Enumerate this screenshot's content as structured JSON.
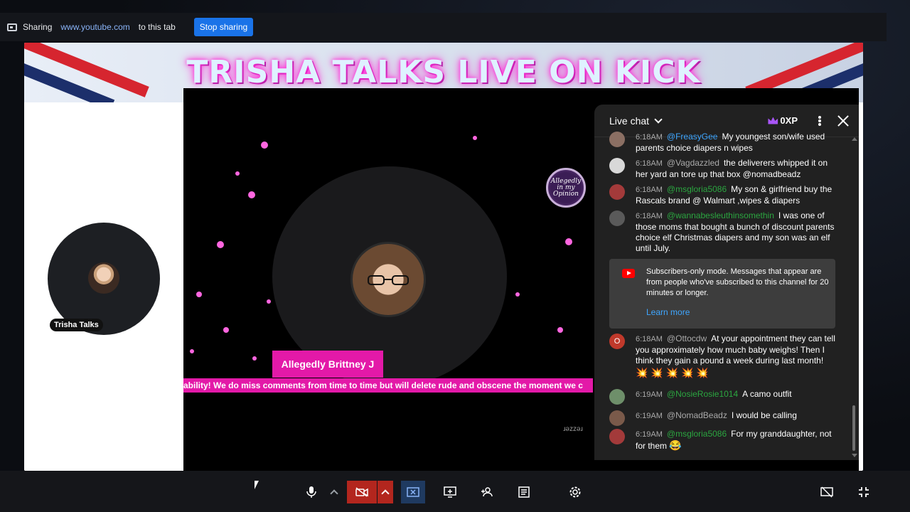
{
  "share_bar": {
    "label": "Sharing",
    "site": "www.youtube.com",
    "suffix": "to this tab",
    "stop_button": "Stop sharing"
  },
  "banner": {
    "title": "TRISHA TALKS LIVE ON KICK"
  },
  "participant": {
    "name": "Trisha Talks"
  },
  "video": {
    "name_tag": "Allegedly Brittney J",
    "ticker": "ability! We do miss comments from time to time but will delete rude and obscene the moment we c",
    "logo_text": "Allegedly in my Opinion",
    "eyes_mark": "ɹǝzzǝɹ"
  },
  "chat": {
    "title": "Live chat",
    "xp": "0XP",
    "messages": [
      {
        "time": "6:18AM",
        "user": "@FreasyGee",
        "text": "My youngest son/wife used parents choice diapers n wipes",
        "member": false
      },
      {
        "time": "6:18AM",
        "user": "@Vagdazzled",
        "text": "the deliverers whipped it on her yard an tore up that box @nomadbeadz",
        "member": false
      },
      {
        "time": "6:18AM",
        "user": "@msgloria5086",
        "text": "My son & girlfriend buy the Rascals brand @ Walmart ,wipes & diapers",
        "member": true
      },
      {
        "time": "6:18AM",
        "user": "@wannabesleuthinsomethin",
        "text": "I was one of those moms that bought a bunch of discount parents choice elf Christmas diapers and my son was an elf until July.",
        "member": true
      },
      {
        "time": "6:18AM",
        "user": "@Ottocdw",
        "text": "At your appointment they can tell you approximately how much baby weighs! Then I think they gain a pound a week during last month!",
        "member": false,
        "avatar_letter": "O",
        "emoji": "💥 💥 💥 💥 💥"
      },
      {
        "time": "6:19AM",
        "user": "@NosieRosie1014",
        "text": "A camo outfit",
        "member": true
      },
      {
        "time": "6:19AM",
        "user": "@NomadBeadz",
        "text": "I would be calling",
        "member": false
      },
      {
        "time": "6:19AM",
        "user": "@msgloria5086",
        "text": "For my granddaughter, not for them",
        "member": true,
        "emoji": "😂"
      }
    ],
    "notice": {
      "text": "Subscribers-only mode. Messages that appear are from people who've subscribed to this channel for 20 minutes or longer.",
      "link": "Learn more"
    }
  },
  "controls": [
    "microphone",
    "mic-options",
    "camera-off",
    "camera-options",
    "stop-presenting",
    "present",
    "add-people",
    "captions",
    "settings",
    "hide-self-view",
    "exit-fullscreen"
  ],
  "colors": {
    "accent_pink": "#e319a8",
    "chat_bg": "#212121",
    "member_green": "#2ba640",
    "link_blue": "#3ea6ff",
    "stop_blue": "#1a73e8",
    "cam_red": "#b3261e"
  }
}
